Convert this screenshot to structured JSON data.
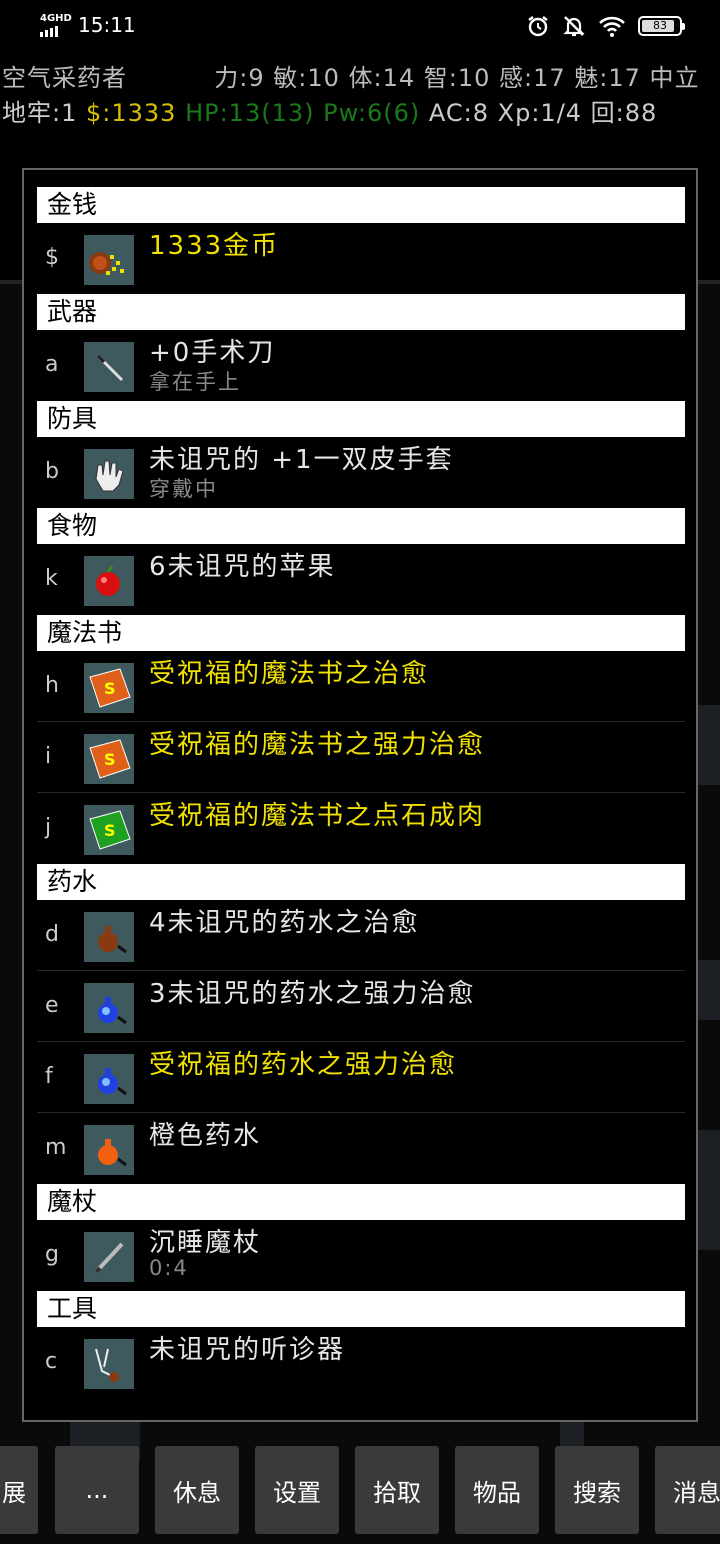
{
  "status_bar": {
    "network": "4GHD",
    "time": "15:11",
    "battery": "83",
    "icons": [
      "alarm-icon",
      "bell-off-icon",
      "wifi-icon",
      "battery-icon"
    ]
  },
  "hud": {
    "line1_name": "空气采药者",
    "line1_stats": "力:9 敏:10 体:14 智:10 感:17 魅:17 中立",
    "dlvl": "地牢:1",
    "gold": "$:1333",
    "hp": "HP:13(13)",
    "pw": "Pw:6(6)",
    "rest": "AC:8 Xp:1/4 回:88"
  },
  "inventory": [
    {
      "category": "金钱",
      "items": [
        {
          "letter": "$",
          "name": "1333金币",
          "status": "",
          "blessed": true,
          "icon": "gold-coins-icon"
        }
      ]
    },
    {
      "category": "武器",
      "items": [
        {
          "letter": "a",
          "name": "+0手术刀",
          "status": "拿在手上",
          "blessed": false,
          "icon": "scalpel-icon"
        }
      ]
    },
    {
      "category": "防具",
      "items": [
        {
          "letter": "b",
          "name": "未诅咒的 +1一双皮手套",
          "status": "穿戴中",
          "blessed": false,
          "icon": "glove-icon"
        }
      ]
    },
    {
      "category": "食物",
      "items": [
        {
          "letter": "k",
          "name": "6未诅咒的苹果",
          "status": "",
          "blessed": false,
          "icon": "apple-icon"
        }
      ]
    },
    {
      "category": "魔法书",
      "items": [
        {
          "letter": "h",
          "name": "受祝福的魔法书之治愈",
          "status": "",
          "blessed": true,
          "icon": "spellbook-orange-icon"
        },
        {
          "letter": "i",
          "name": "受祝福的魔法书之强力治愈",
          "status": "",
          "blessed": true,
          "icon": "spellbook-orange-icon"
        },
        {
          "letter": "j",
          "name": "受祝福的魔法书之点石成肉",
          "status": "",
          "blessed": true,
          "icon": "spellbook-green-icon"
        }
      ]
    },
    {
      "category": "药水",
      "items": [
        {
          "letter": "d",
          "name": "4未诅咒的药水之治愈",
          "status": "",
          "blessed": false,
          "icon": "potion-brown-icon"
        },
        {
          "letter": "e",
          "name": "3未诅咒的药水之强力治愈",
          "status": "",
          "blessed": false,
          "icon": "potion-blue-icon"
        },
        {
          "letter": "f",
          "name": "受祝福的药水之强力治愈",
          "status": "",
          "blessed": true,
          "icon": "potion-blue-icon"
        },
        {
          "letter": "m",
          "name": "橙色药水",
          "status": "",
          "blessed": false,
          "icon": "potion-orange-icon"
        }
      ]
    },
    {
      "category": "魔杖",
      "items": [
        {
          "letter": "g",
          "name": "沉睡魔杖",
          "status": "0:4",
          "blessed": false,
          "icon": "wand-icon"
        }
      ]
    },
    {
      "category": "工具",
      "items": [
        {
          "letter": "c",
          "name": "未诅咒的听诊器",
          "status": "",
          "blessed": false,
          "icon": "stethoscope-icon"
        }
      ]
    }
  ],
  "bottom_buttons": [
    "展",
    "...",
    "休息",
    "设置",
    "拾取",
    "物品",
    "搜索",
    "消息"
  ]
}
